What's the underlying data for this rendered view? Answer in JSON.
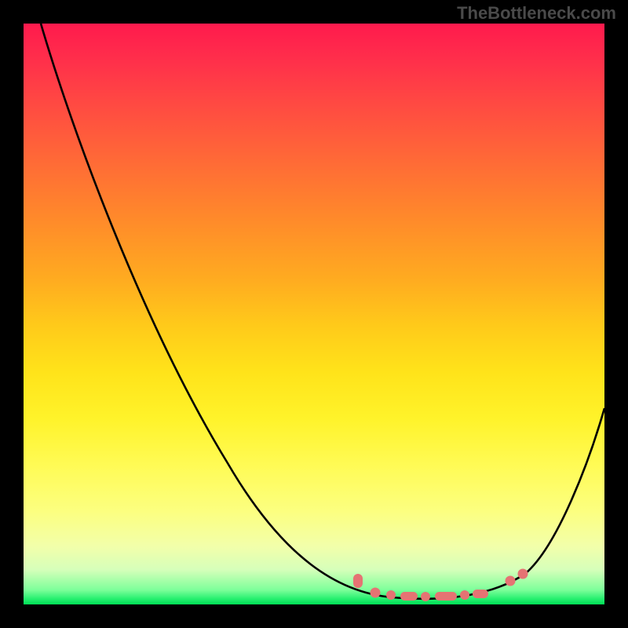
{
  "watermark": "TheBottleneck.com",
  "chart_data": {
    "type": "line",
    "title": "",
    "xlabel": "",
    "ylabel": "",
    "xlim": [
      0,
      100
    ],
    "ylim": [
      0,
      100
    ],
    "background_gradient": {
      "orientation": "vertical",
      "stops": [
        {
          "pos": 0.0,
          "color": "#ff1a4d"
        },
        {
          "pos": 0.5,
          "color": "#ffca1a"
        },
        {
          "pos": 0.85,
          "color": "#fcff80"
        },
        {
          "pos": 1.0,
          "color": "#00dd55"
        }
      ]
    },
    "series": [
      {
        "name": "bottleneck-curve",
        "x": [
          3,
          10,
          20,
          30,
          40,
          50,
          60,
          65,
          70,
          75,
          80,
          85,
          90,
          95,
          100
        ],
        "y": [
          100,
          86,
          68,
          50,
          35,
          22,
          12,
          6,
          3,
          1.5,
          1,
          2,
          5,
          15,
          34
        ],
        "stroke": "#000000"
      }
    ],
    "markers": {
      "name": "valley-points",
      "color": "#e57373",
      "x": [
        57,
        60.5,
        63,
        66,
        69,
        72,
        76,
        79,
        84,
        86
      ],
      "y": [
        5,
        2,
        1.6,
        1.3,
        1.1,
        1.2,
        1.6,
        2.2,
        4,
        5.5
      ]
    },
    "notes": "No axis ticks or numeric labels are rendered in the image; x and y are normalized 0–100 estimates read off the plot area. The background gradient encodes the same y-dimension (red=high bottleneck, green=low)."
  }
}
